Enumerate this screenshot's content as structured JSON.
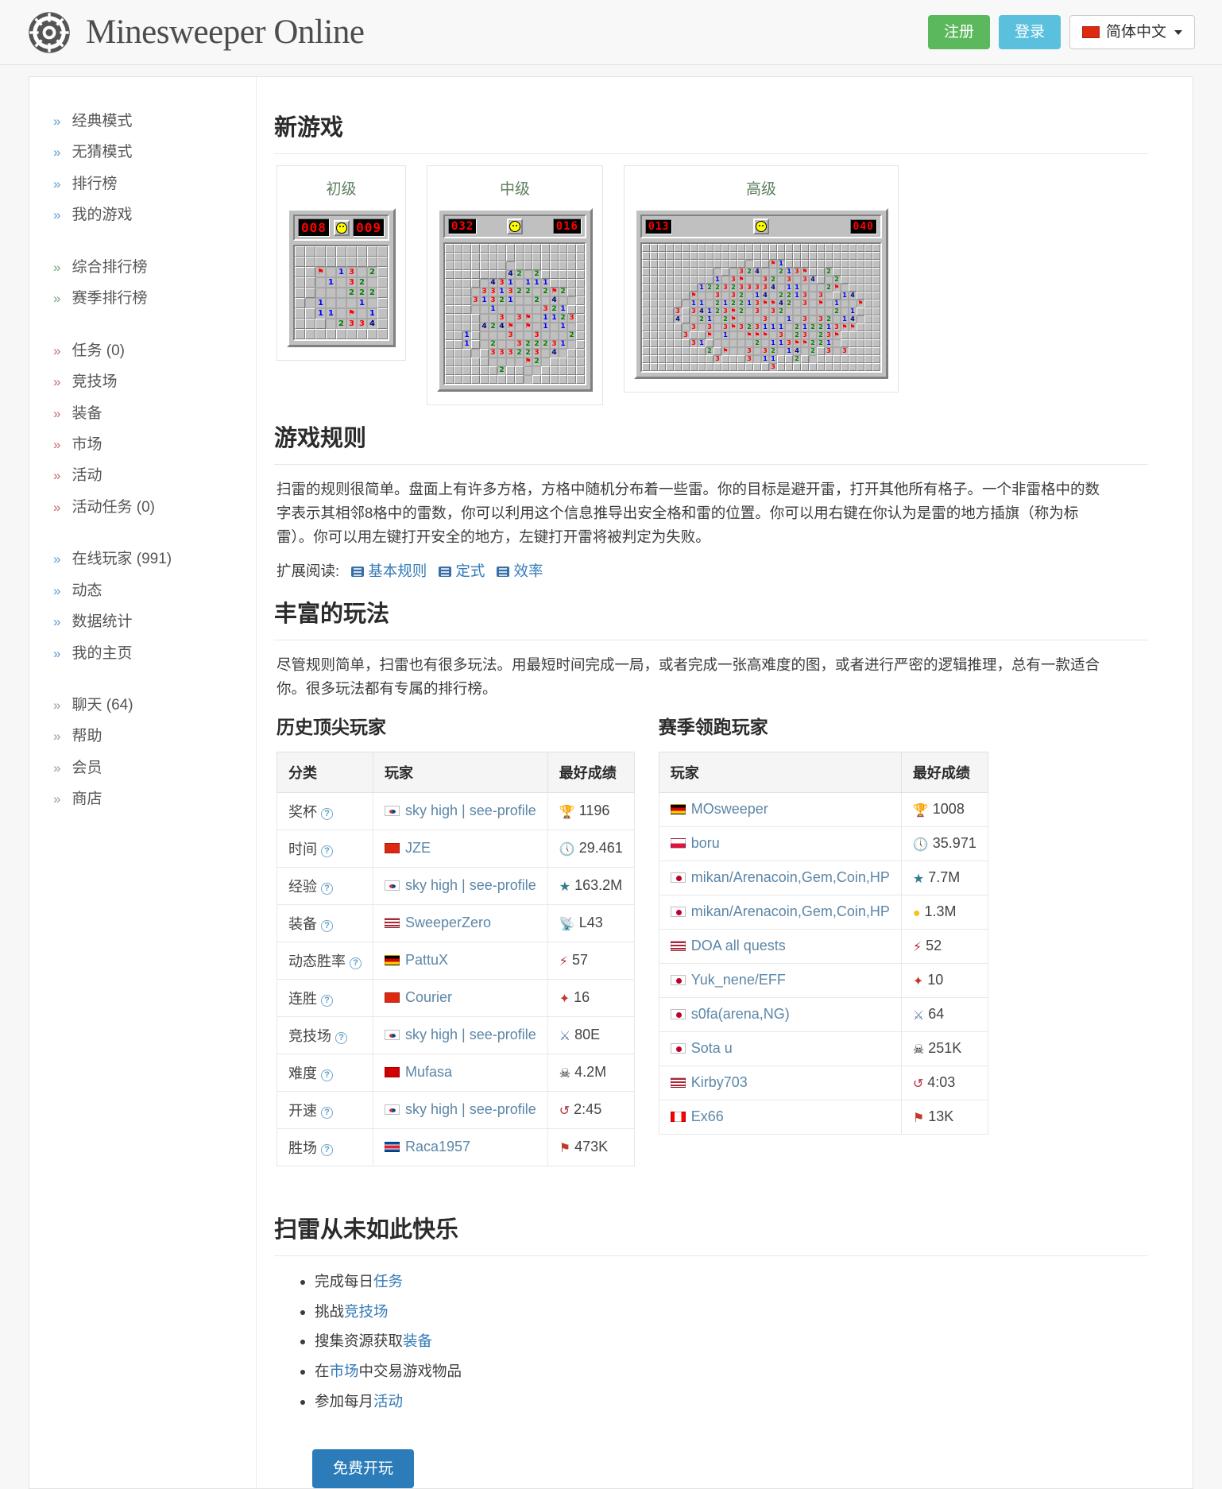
{
  "header": {
    "brand": "Minesweeper Online",
    "logo_icon": "gear-logo-icon",
    "register_label": "注册",
    "login_label": "登录",
    "language_label": "简体中文",
    "language_flag": "cn-flag-icon",
    "colors": {
      "register": "#5cb85c",
      "login": "#5bc0de",
      "cta": "#2b7cb9"
    }
  },
  "sidebar": {
    "groups": [
      {
        "color": "blue",
        "items": [
          {
            "label": "经典模式"
          },
          {
            "label": "无猜模式"
          },
          {
            "label": "排行榜"
          },
          {
            "label": "我的游戏"
          }
        ]
      },
      {
        "color": "green",
        "items": [
          {
            "label": "综合排行榜"
          },
          {
            "label": "赛季排行榜"
          }
        ]
      },
      {
        "color": "red",
        "items": [
          {
            "label": "任务 (0)"
          },
          {
            "label": "竞技场"
          },
          {
            "label": "装备"
          },
          {
            "label": "市场"
          },
          {
            "label": "活动"
          },
          {
            "label": "活动任务 (0)"
          }
        ]
      },
      {
        "color": "blue",
        "items": [
          {
            "label": "在线玩家 (991)"
          },
          {
            "label": "动态"
          },
          {
            "label": "数据统计"
          },
          {
            "label": "我的主页"
          }
        ]
      },
      {
        "color": "gray",
        "items": [
          {
            "label": "聊天 (64)"
          },
          {
            "label": "帮助"
          },
          {
            "label": "会员"
          },
          {
            "label": "商店"
          }
        ]
      }
    ]
  },
  "new_game": {
    "heading": "新游戏",
    "boards": [
      {
        "title": "初级",
        "mines_display": "008",
        "timer_display": "009",
        "cols": 9,
        "rows": 9,
        "cell": 13
      },
      {
        "title": "中级",
        "mines_display": "032",
        "timer_display": "016",
        "cols": 16,
        "rows": 16,
        "cell": 11
      },
      {
        "title": "高级",
        "mines_display": "013",
        "timer_display": "040",
        "cols": 30,
        "rows": 16,
        "cell": 10
      }
    ]
  },
  "rules": {
    "heading": "游戏规则",
    "paragraph": "扫雷的规则很简单。盘面上有许多方格，方格中随机分布着一些雷。你的目标是避开雷，打开其他所有格子。一个非雷格中的数字表示其相邻8格中的雷数，你可以利用这个信息推导出安全格和雷的位置。你可以用右键在你认为是雷的地方插旗（称为标雷）。你可以用左键打开安全的地方，左键打开雷将被判定为失败。",
    "reading_label": "扩展阅读:",
    "reading_links": [
      {
        "label": "基本规则",
        "icon": "book-icon"
      },
      {
        "label": "定式",
        "icon": "book-icon"
      },
      {
        "label": "效率",
        "icon": "book-icon"
      }
    ]
  },
  "variety": {
    "heading": "丰富的玩法",
    "paragraph": "尽管规则简单，扫雷也有很多玩法。用最短时间完成一局，或者完成一张高难度的图，或者进行严密的逻辑推理，总有一款适合你。很多玩法都有专属的排行榜。"
  },
  "top_players": {
    "heading": "历史顶尖玩家",
    "columns": [
      "分类",
      "玩家",
      "最好成绩"
    ],
    "rows": [
      {
        "category": "奖杯",
        "flag": "kr",
        "player": "sky high | see-profile",
        "icon": "trophy-icon",
        "value": "1196"
      },
      {
        "category": "时间",
        "flag": "cn",
        "player": "JZE",
        "icon": "clock-icon",
        "value": "29.461"
      },
      {
        "category": "经验",
        "flag": "kr",
        "player": "sky high | see-profile",
        "icon": "star-icon",
        "value": "163.2M"
      },
      {
        "category": "装备",
        "flag": "us",
        "player": "SweeperZero",
        "icon": "wand-icon",
        "value": "L43"
      },
      {
        "category": "动态胜率",
        "flag": "de",
        "player": "PattuX",
        "icon": "bolt-icon",
        "value": "57"
      },
      {
        "category": "连胜",
        "flag": "cn",
        "player": "Courier",
        "icon": "compass-icon",
        "value": "16"
      },
      {
        "category": "竞技场",
        "flag": "kr",
        "player": "sky high | see-profile",
        "icon": "swords-icon",
        "value": "80E"
      },
      {
        "category": "难度",
        "flag": "mk",
        "player": "Mufasa",
        "icon": "skull-icon",
        "value": "4.2M"
      },
      {
        "category": "开速",
        "flag": "kr",
        "player": "sky high | see-profile",
        "icon": "rewind-icon",
        "value": "2:45"
      },
      {
        "category": "胜场",
        "flag": "kp",
        "player": "Raca1957",
        "icon": "flag-icon",
        "value": "473K"
      }
    ]
  },
  "season_leaders": {
    "heading": "赛季领跑玩家",
    "columns": [
      "玩家",
      "最好成绩"
    ],
    "rows": [
      {
        "flag": "de",
        "player": "MOsweeper",
        "icon": "trophy-icon",
        "value": "1008"
      },
      {
        "flag": "pl",
        "player": "boru",
        "icon": "clock-icon",
        "value": "35.971"
      },
      {
        "flag": "jp",
        "player": "mikan/Arenacoin,Gem,Coin,HP",
        "icon": "star-icon",
        "value": "7.7M"
      },
      {
        "flag": "jp",
        "player": "mikan/Arenacoin,Gem,Coin,HP",
        "icon": "coin-icon",
        "value": "1.3M"
      },
      {
        "flag": "us",
        "player": "DOA all quests",
        "icon": "bolt-icon",
        "value": "52"
      },
      {
        "flag": "jp",
        "player": "Yuk_nene/EFF",
        "icon": "compass-icon",
        "value": "10"
      },
      {
        "flag": "jp",
        "player": "s0fa(arena,NG)",
        "icon": "swords-icon",
        "value": "64"
      },
      {
        "flag": "jp",
        "player": "Sota u",
        "icon": "skull-icon",
        "value": "251K"
      },
      {
        "flag": "us",
        "player": "Kirby703",
        "icon": "rewind-icon",
        "value": "4:03"
      },
      {
        "flag": "ca",
        "player": "Ex66",
        "icon": "flag-icon",
        "value": "13K"
      }
    ]
  },
  "fun": {
    "heading": "扫雷从未如此快乐",
    "items": [
      {
        "prefix": "完成每日",
        "link": "任务",
        "suffix": ""
      },
      {
        "prefix": "挑战",
        "link": "竞技场",
        "suffix": ""
      },
      {
        "prefix": "搜集资源获取",
        "link": "装备",
        "suffix": ""
      },
      {
        "prefix": "在",
        "link": "市场",
        "suffix": "中交易游戏物品"
      },
      {
        "prefix": "参加每月",
        "link": "活动",
        "suffix": ""
      }
    ],
    "cta_label": "免费开玩"
  }
}
